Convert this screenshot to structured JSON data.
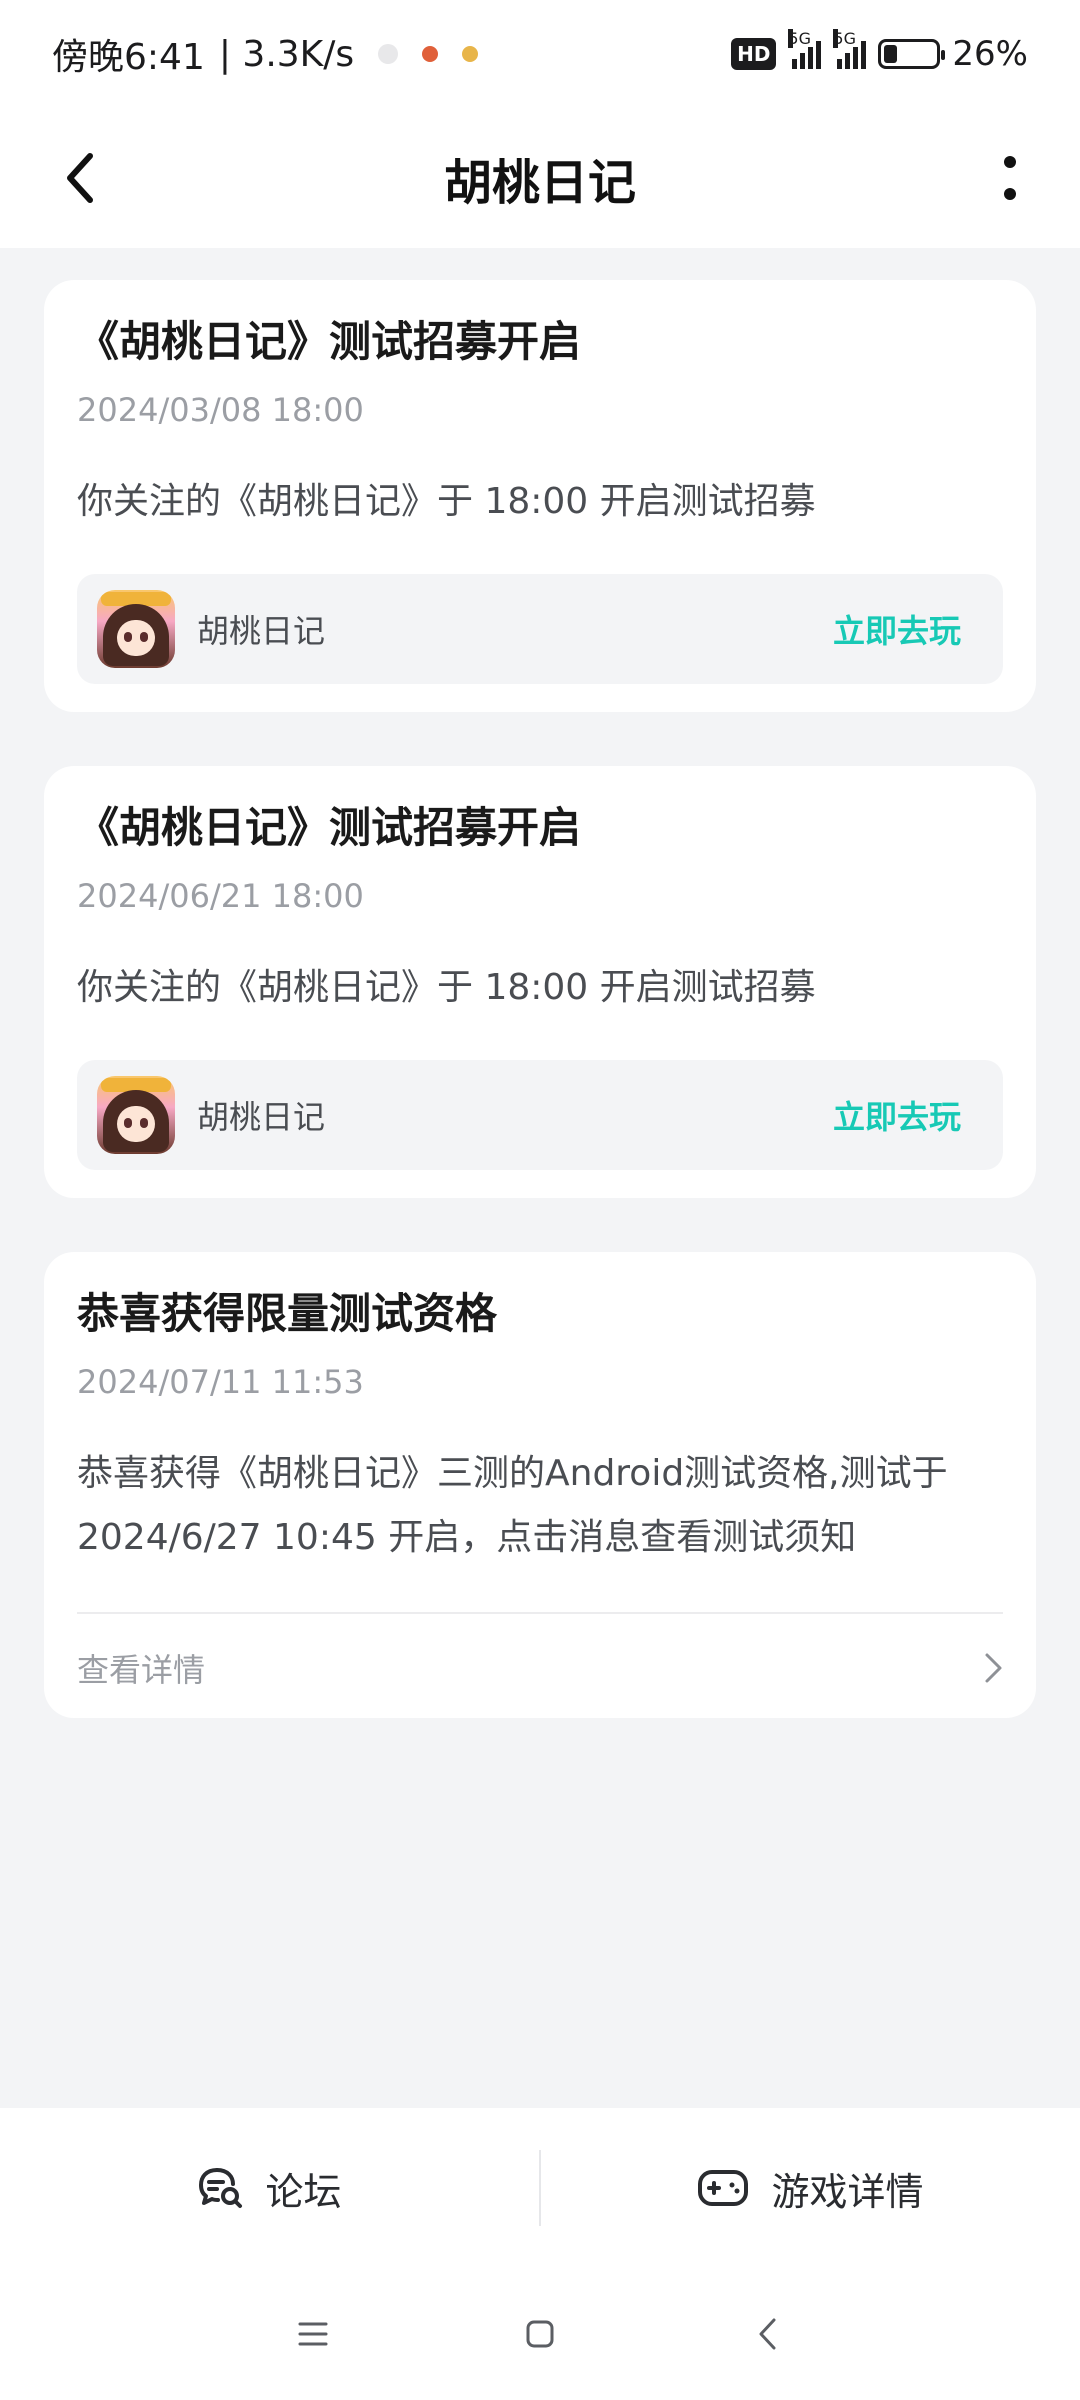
{
  "status_bar": {
    "time": "傍晚6:41",
    "speed": "| 3.3K/s",
    "hd": "HD",
    "net1": "5G",
    "net2": "5G",
    "battery": "26%",
    "battery_fraction": 0.26
  },
  "header": {
    "title": "胡桃日记",
    "back_icon": "chevron-left-icon",
    "more_icon": "more-vertical-icon"
  },
  "notifications": [
    {
      "title": "《胡桃日记》测试招募开启",
      "time": "2024/03/08 18:00",
      "body": "你关注的《胡桃日记》于 18:00 开启测试招募",
      "game_name": "胡桃日记",
      "action": "立即去玩"
    },
    {
      "title": "《胡桃日记》测试招募开启",
      "time": "2024/06/21 18:00",
      "body": "你关注的《胡桃日记》于 18:00 开启测试招募",
      "game_name": "胡桃日记",
      "action": "立即去玩"
    },
    {
      "title": "恭喜获得限量测试资格",
      "time": "2024/07/11 11:53",
      "body": "恭喜获得《胡桃日记》三测的Android测试资格,测试于 2024/6/27 10:45 开启，点击消息查看测试须知",
      "detail_label": "查看详情"
    }
  ],
  "bottom_bar": {
    "forum_label": "论坛",
    "forum_icon": "forum-chat-search-icon",
    "game_detail_label": "游戏详情",
    "game_detail_icon": "gamepad-icon"
  },
  "nav_bar": {
    "menu_icon": "menu-icon",
    "home_icon": "home-square-icon",
    "back_icon": "back-triangle-icon"
  },
  "colors": {
    "accent": "#17c9b5",
    "background": "#f3f4f6",
    "card": "#ffffff"
  }
}
